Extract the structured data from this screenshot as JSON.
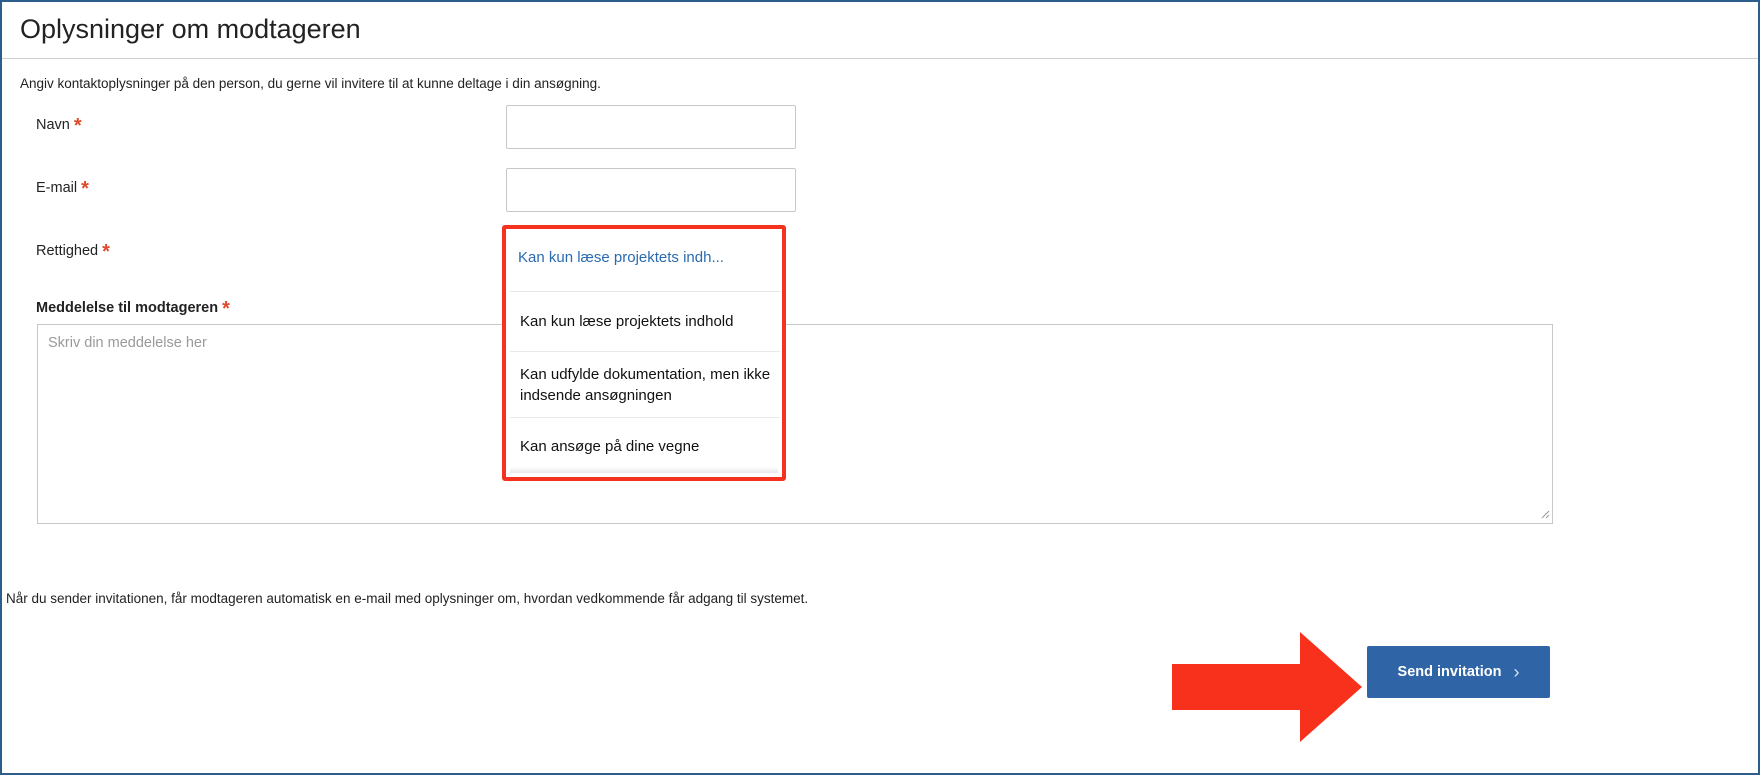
{
  "header": {
    "title": "Oplysninger om modtageren"
  },
  "intro_text": "Angiv kontaktoplysninger på den person, du gerne vil invitere til at kunne deltage i din ansøgning.",
  "form": {
    "name": {
      "label": "Navn",
      "value": ""
    },
    "email": {
      "label": "E-mail",
      "value": ""
    },
    "permission": {
      "label": "Rettighed",
      "selected": "Kan kun læse projektets indh...",
      "options": [
        "Kan kun læse projektets indhold",
        "Kan udfylde dokumentation, men ikke indsende ansøgningen",
        "Kan ansøge på dine vegne"
      ]
    },
    "message": {
      "label": "Meddelelse til modtageren",
      "placeholder": "Skriv din meddelelse her"
    },
    "required_marker": "*"
  },
  "note": "Når du sender invitationen, får modtageren automatisk en e-mail med oplysninger om, hvordan vedkommende får adgang til systemet.",
  "actions": {
    "send_label": "Send invitation",
    "send_chevron": "›"
  },
  "colors": {
    "accent": "#2f65a6",
    "required": "#e04a2b",
    "highlight": "#f5321e",
    "link": "#2a6bb0"
  },
  "icons": {
    "callout_arrow": "right-arrow-icon",
    "resize": "resize-grip-icon",
    "chevron": "chevron-right-icon"
  }
}
